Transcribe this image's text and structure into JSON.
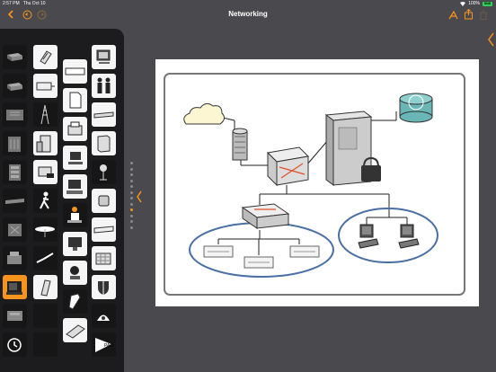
{
  "status": {
    "time": "2:57 PM",
    "date": "Thu Oct 10",
    "battery": "100%",
    "battery_icon_text": "SNS"
  },
  "nav": {
    "title": "Networking",
    "back_icon": "chevron-left",
    "undo_icon": "undo",
    "redo_icon": "redo",
    "tools_icon": "tools",
    "share_icon": "share",
    "trash_icon": "trash"
  },
  "palette": {
    "selected": "network-card",
    "items": [
      "router-flat",
      "notepad",
      "tablet-workstation",
      "ethernet-switch",
      "modem",
      "cable-box",
      "pc-monitor",
      "mux",
      "rack-unit",
      "document",
      "users",
      "fax",
      "cell-tower",
      "fiber-switch",
      "server-tower",
      "building",
      "desktop-pc",
      "patch-panel",
      "phone",
      "webcam",
      "server-stack",
      "terminal",
      "telephone",
      "scanner",
      "ethernet-hub",
      "walker-person",
      "desktop-user",
      "mini-server",
      "firewall",
      "mainframe",
      "monitor",
      "laptop",
      "keyboard",
      "satellite-dish",
      "printer",
      "network-card",
      "pda",
      "security-badge",
      "shield",
      "external-drive",
      "cable",
      "dome-camera",
      "blank",
      "history",
      "tablet-pc",
      "pad-sign"
    ]
  },
  "canvas": {
    "page_indicator_count": 12,
    "page_indicator_active": 9
  },
  "colors": {
    "accent": "#f7941d",
    "ellipse_stroke": "#4a6fa5",
    "cloud_fill": "#fdf6d3",
    "clock_fill": "#6ab5b5"
  }
}
